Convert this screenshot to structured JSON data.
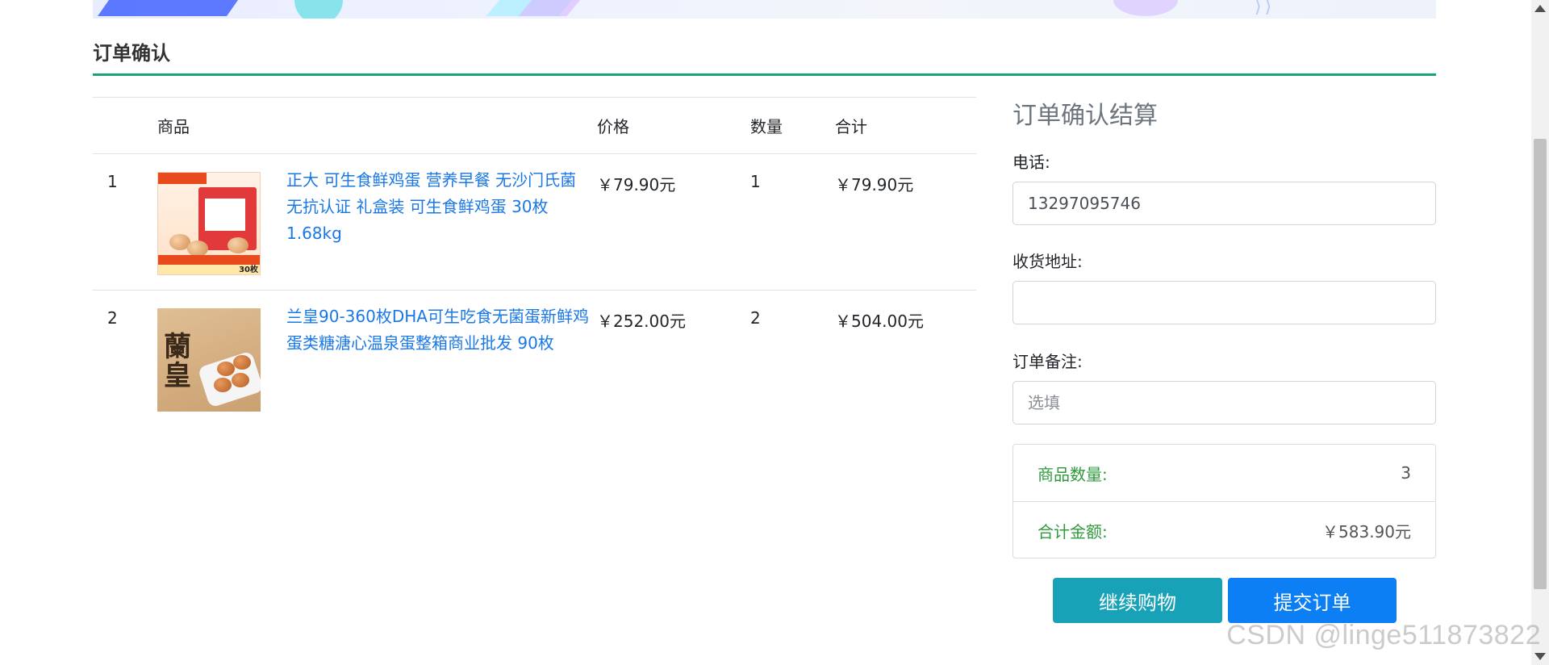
{
  "page": {
    "title": "订单确认"
  },
  "table": {
    "headers": {
      "product": "商品",
      "price": "价格",
      "quantity": "数量",
      "subtotal": "合计"
    },
    "rows": [
      {
        "index": "1",
        "image_icon": "egg-gift-box-image",
        "name": "正大 可生食鲜鸡蛋 营养早餐 无沙门氏菌 无抗认证 礼盒装 可生食鲜鸡蛋 30枚 1.68kg",
        "price": "￥79.90元",
        "quantity": "1",
        "subtotal": "￥79.90元"
      },
      {
        "index": "2",
        "image_icon": "egg-carton-image",
        "name": "兰皇90-360枚DHA可生吃食无菌蛋新鲜鸡蛋类糖溏心温泉蛋整箱商业批发 90枚",
        "price": "￥252.00元",
        "quantity": "2",
        "subtotal": "￥504.00元"
      }
    ]
  },
  "checkout": {
    "title": "订单确认结算",
    "phone_label": "电话:",
    "phone_value": "13297095746",
    "address_label": "收货地址:",
    "address_value": "",
    "note_label": "订单备注:",
    "note_placeholder": "选填",
    "summary": {
      "count_label": "商品数量:",
      "count_value": "3",
      "total_label": "合计金额:",
      "total_value": "￥583.90元"
    },
    "continue_button": "继续购物",
    "submit_button": "提交订单"
  },
  "watermark": "CSDN @linge511873822",
  "colors": {
    "accent_rule": "#17a47a",
    "link": "#1a78e6",
    "summary_label": "#2e9a3c",
    "continue_button": "#17a2b8",
    "submit_button": "#0d7ff5"
  }
}
